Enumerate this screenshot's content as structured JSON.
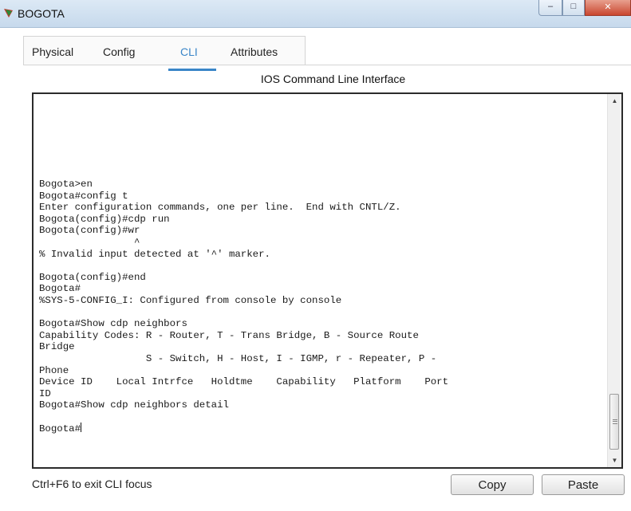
{
  "window": {
    "title": "BOGOTA",
    "controls": {
      "minimize": "–",
      "maximize": "□",
      "close": "✕"
    }
  },
  "tabs": [
    {
      "label": "Physical",
      "active": false
    },
    {
      "label": "Config",
      "active": false
    },
    {
      "label": "CLI",
      "active": true
    },
    {
      "label": "Attributes",
      "active": false
    }
  ],
  "cli": {
    "header": "IOS Command Line Interface",
    "lines": [
      "Bogota>en",
      "Bogota#config t",
      "Enter configuration commands, one per line.  End with CNTL/Z.",
      "Bogota(config)#cdp run",
      "Bogota(config)#wr",
      "                ^",
      "% Invalid input detected at '^' marker.",
      "",
      "Bogota(config)#end",
      "Bogota#",
      "%SYS-5-CONFIG_I: Configured from console by console",
      "",
      "Bogota#Show cdp neighbors",
      "Capability Codes: R - Router, T - Trans Bridge, B - Source Route",
      "Bridge",
      "                  S - Switch, H - Host, I - IGMP, r - Repeater, P -",
      "Phone",
      "Device ID    Local Intrfce   Holdtme    Capability   Platform    Port",
      "ID",
      "Bogota#Show cdp neighbors detail",
      ""
    ],
    "prompt": "Bogota#"
  },
  "footer": {
    "hint": "Ctrl+F6 to exit CLI focus",
    "copy_label": "Copy",
    "paste_label": "Paste"
  },
  "colors": {
    "accent": "#3a86c8",
    "title_bar": "#c6d9ec",
    "close_button": "#c9472f",
    "terminal_border": "#2b2b2b"
  },
  "icons": [
    "packet-tracer-app-icon",
    "minimize-icon",
    "maximize-icon",
    "close-icon",
    "scroll-up-arrow-icon",
    "scroll-down-arrow-icon"
  ]
}
